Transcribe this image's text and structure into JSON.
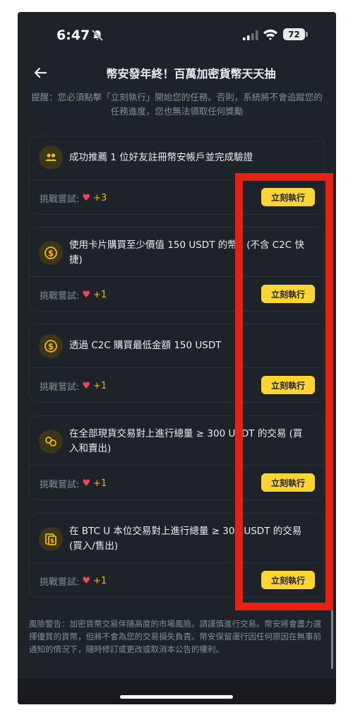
{
  "status_bar": {
    "time": "6:47",
    "battery": "72"
  },
  "header": {
    "title": "幣安發年終！百萬加密貨幣天天抽"
  },
  "reminder": "提醒：您必須點擊「立刻執行」開始您的任務。否則，系統將不會追蹤您的任務進度，您也無法領取任何獎勵",
  "tasks": [
    {
      "icon": "users-icon",
      "text": "成功推薦 1 位好友註冊幣安帳戶並完成驗證",
      "attempt_label": "挑戰嘗試:",
      "attempt_count": "+3",
      "button": "立刻執行"
    },
    {
      "icon": "dollar-coin-icon",
      "text": "使用卡片購買至少價值 150 USDT 的幣。(不含 C2C 快捷)",
      "attempt_label": "挑戰嘗試:",
      "attempt_count": "+1",
      "button": "立刻執行"
    },
    {
      "icon": "dollar-coin-icon",
      "text": "透過 C2C 購買最低金額 150 USDT",
      "attempt_label": "挑戰嘗試:",
      "attempt_count": "+1",
      "button": "立刻執行"
    },
    {
      "icon": "exchange-icon",
      "text": "在全部現貨交易對上進行總量 ≥ 300 USDT 的交易 (買入和賣出)",
      "attempt_label": "挑戰嘗試:",
      "attempt_count": "+1",
      "button": "立刻執行"
    },
    {
      "icon": "futures-icon",
      "text": "在 BTC U 本位交易對上進行總量 ≥ 300 USDT 的交易 (買入/售出)",
      "attempt_label": "挑戰嘗試:",
      "attempt_count": "+1",
      "button": "立刻執行"
    }
  ],
  "risk_warning": "風險警告：加密貨幣交易伴隨高度的市場風險。請謹慎進行交易。幣安將會盡力選擇優質的貨幣，但將不會為您的交易損失負責。幣安保留運行因任何原因在無事前通知的情況下，隨時修訂或更改或取消本公告的權利。",
  "colors": {
    "background": "#1e2329",
    "accent": "#fcd535",
    "heart": "#f6465d",
    "highlight": "#e52114"
  }
}
